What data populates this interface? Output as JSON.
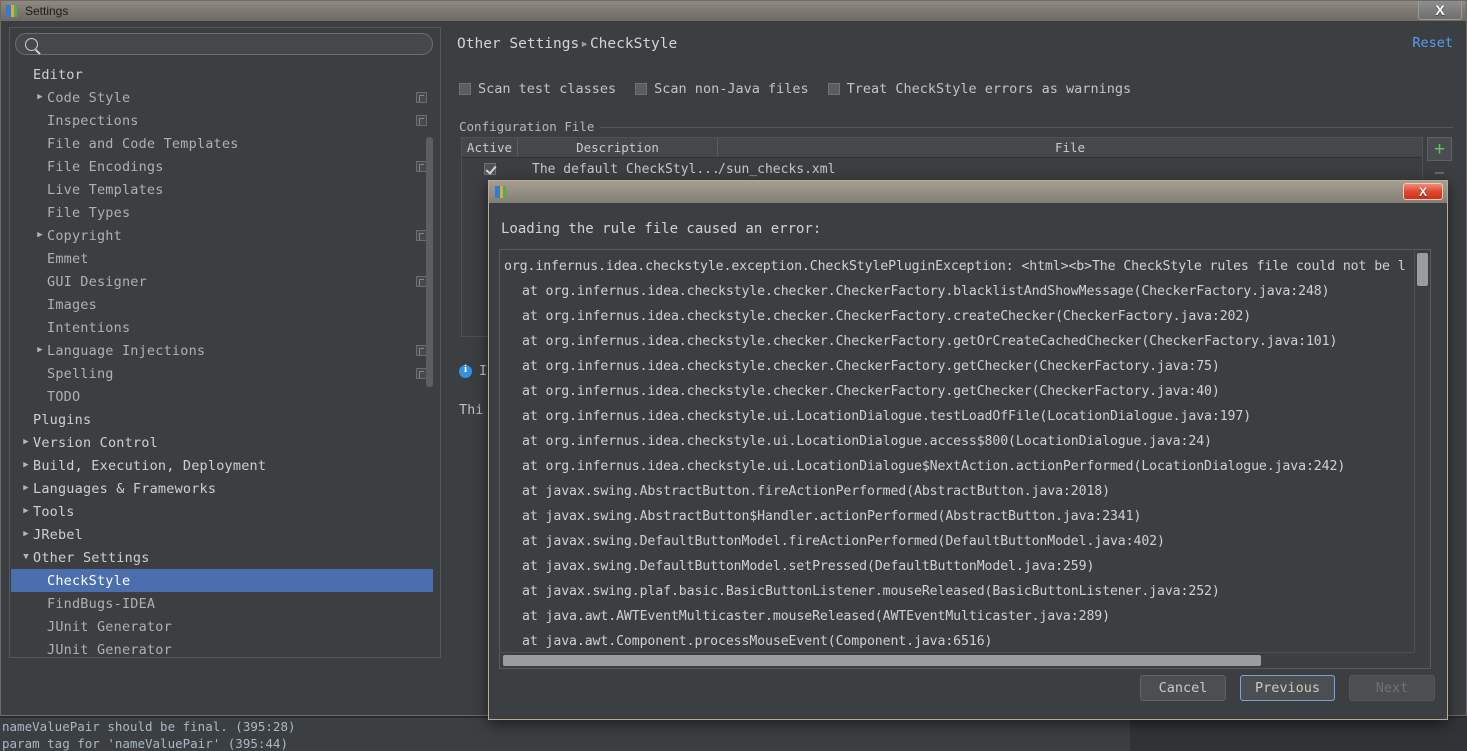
{
  "window": {
    "title": "Settings",
    "close_label": "X",
    "app_icon": "intellij-idea-icon"
  },
  "search": {
    "value": "",
    "placeholder": ""
  },
  "sidebar": {
    "items": [
      {
        "label": "Editor",
        "depth": 0,
        "arrow": "",
        "scope_icon": false,
        "selected": false
      },
      {
        "label": "Code Style",
        "depth": 1,
        "arrow": "▶",
        "scope_icon": true,
        "selected": false
      },
      {
        "label": "Inspections",
        "depth": 1,
        "arrow": "",
        "scope_icon": true,
        "selected": false
      },
      {
        "label": "File and Code Templates",
        "depth": 1,
        "arrow": "",
        "scope_icon": false,
        "selected": false
      },
      {
        "label": "File Encodings",
        "depth": 1,
        "arrow": "",
        "scope_icon": true,
        "selected": false
      },
      {
        "label": "Live Templates",
        "depth": 1,
        "arrow": "",
        "scope_icon": false,
        "selected": false
      },
      {
        "label": "File Types",
        "depth": 1,
        "arrow": "",
        "scope_icon": false,
        "selected": false
      },
      {
        "label": "Copyright",
        "depth": 1,
        "arrow": "▶",
        "scope_icon": true,
        "selected": false
      },
      {
        "label": "Emmet",
        "depth": 1,
        "arrow": "",
        "scope_icon": false,
        "selected": false
      },
      {
        "label": "GUI Designer",
        "depth": 1,
        "arrow": "",
        "scope_icon": true,
        "selected": false
      },
      {
        "label": "Images",
        "depth": 1,
        "arrow": "",
        "scope_icon": false,
        "selected": false
      },
      {
        "label": "Intentions",
        "depth": 1,
        "arrow": "",
        "scope_icon": false,
        "selected": false
      },
      {
        "label": "Language Injections",
        "depth": 1,
        "arrow": "▶",
        "scope_icon": true,
        "selected": false
      },
      {
        "label": "Spelling",
        "depth": 1,
        "arrow": "",
        "scope_icon": true,
        "selected": false
      },
      {
        "label": "TODO",
        "depth": 1,
        "arrow": "",
        "scope_icon": false,
        "selected": false
      },
      {
        "label": "Plugins",
        "depth": 0,
        "arrow": "",
        "scope_icon": false,
        "selected": false
      },
      {
        "label": "Version Control",
        "depth": 0,
        "arrow": "▶",
        "scope_icon": false,
        "selected": false
      },
      {
        "label": "Build, Execution, Deployment",
        "depth": 0,
        "arrow": "▶",
        "scope_icon": false,
        "selected": false
      },
      {
        "label": "Languages & Frameworks",
        "depth": 0,
        "arrow": "▶",
        "scope_icon": false,
        "selected": false
      },
      {
        "label": "Tools",
        "depth": 0,
        "arrow": "▶",
        "scope_icon": false,
        "selected": false
      },
      {
        "label": "JRebel",
        "depth": 0,
        "arrow": "▶",
        "scope_icon": false,
        "selected": false
      },
      {
        "label": "Other Settings",
        "depth": 0,
        "arrow": "▼",
        "scope_icon": false,
        "selected": false
      },
      {
        "label": "CheckStyle",
        "depth": 1,
        "arrow": "",
        "scope_icon": false,
        "selected": true
      },
      {
        "label": "FindBugs-IDEA",
        "depth": 1,
        "arrow": "",
        "scope_icon": false,
        "selected": false
      },
      {
        "label": "JUnit Generator",
        "depth": 1,
        "arrow": "",
        "scope_icon": false,
        "selected": false
      },
      {
        "label": "JUnit Generator",
        "depth": 1,
        "arrow": "",
        "scope_icon": false,
        "selected": false
      }
    ]
  },
  "main": {
    "breadcrumb_parent": "Other Settings",
    "breadcrumb_separator": "▸",
    "breadcrumb_current": "CheckStyle",
    "reset_label": "Reset",
    "options": [
      {
        "label": "Scan test classes",
        "checked": false
      },
      {
        "label": "Scan non-Java files",
        "checked": false
      },
      {
        "label": "Treat CheckStyle errors as warnings",
        "checked": false
      }
    ],
    "config_group_label": "Configuration File",
    "table": {
      "columns": [
        "Active",
        "Description",
        "File"
      ],
      "rows": [
        {
          "active": true,
          "description": "The default CheckStyl...",
          "file": "/sun_checks.xml"
        }
      ],
      "add_button": "+",
      "remove_button": "–"
    },
    "info_text": "I",
    "description_text": "Thi"
  },
  "dialog": {
    "close_label": "X",
    "message": "Loading the rule file caused an error:",
    "stack_trace": [
      {
        "indent": false,
        "text": "org.infernus.idea.checkstyle.exception.CheckStylePluginException: <html><b>The CheckStyle rules file could not be l"
      },
      {
        "indent": true,
        "text": "at org.infernus.idea.checkstyle.checker.CheckerFactory.blacklistAndShowMessage(CheckerFactory.java:248)"
      },
      {
        "indent": true,
        "text": "at org.infernus.idea.checkstyle.checker.CheckerFactory.createChecker(CheckerFactory.java:202)"
      },
      {
        "indent": true,
        "text": "at org.infernus.idea.checkstyle.checker.CheckerFactory.getOrCreateCachedChecker(CheckerFactory.java:101)"
      },
      {
        "indent": true,
        "text": "at org.infernus.idea.checkstyle.checker.CheckerFactory.getChecker(CheckerFactory.java:75)"
      },
      {
        "indent": true,
        "text": "at org.infernus.idea.checkstyle.checker.CheckerFactory.getChecker(CheckerFactory.java:40)"
      },
      {
        "indent": true,
        "text": "at org.infernus.idea.checkstyle.ui.LocationDialogue.testLoadOfFile(LocationDialogue.java:197)"
      },
      {
        "indent": true,
        "text": "at org.infernus.idea.checkstyle.ui.LocationDialogue.access$800(LocationDialogue.java:24)"
      },
      {
        "indent": true,
        "text": "at org.infernus.idea.checkstyle.ui.LocationDialogue$NextAction.actionPerformed(LocationDialogue.java:242)"
      },
      {
        "indent": true,
        "text": "at javax.swing.AbstractButton.fireActionPerformed(AbstractButton.java:2018)"
      },
      {
        "indent": true,
        "text": "at javax.swing.AbstractButton$Handler.actionPerformed(AbstractButton.java:2341)"
      },
      {
        "indent": true,
        "text": "at javax.swing.DefaultButtonModel.fireActionPerformed(DefaultButtonModel.java:402)"
      },
      {
        "indent": true,
        "text": "at javax.swing.DefaultButtonModel.setPressed(DefaultButtonModel.java:259)"
      },
      {
        "indent": true,
        "text": "at javax.swing.plaf.basic.BasicButtonListener.mouseReleased(BasicButtonListener.java:252)"
      },
      {
        "indent": true,
        "text": "at java.awt.AWTEventMulticaster.mouseReleased(AWTEventMulticaster.java:289)"
      },
      {
        "indent": true,
        "text": "at java.awt.Component.processMouseEvent(Component.java:6516)"
      }
    ],
    "buttons": [
      {
        "label": "Cancel",
        "disabled": false
      },
      {
        "label": "Previous",
        "disabled": false
      },
      {
        "label": "Next",
        "disabled": true
      }
    ]
  },
  "background_editor": {
    "lines": [
      "nameValuePair should be final. (395:28)",
      "param tag for 'nameValuePair' (395:44)"
    ]
  },
  "colors": {
    "accent_selection": "#4b6eaf",
    "link": "#589df6",
    "panel_bg": "#3c3f41",
    "editor_bg": "#2b2b2b",
    "add_green": "#62c462",
    "close_red": "#e04a30"
  }
}
